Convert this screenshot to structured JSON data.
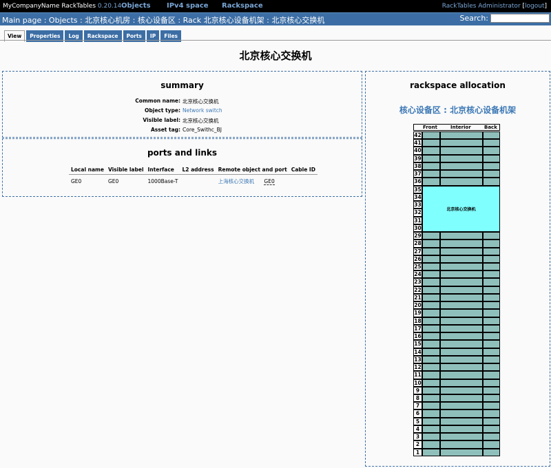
{
  "topbar": {
    "company": "MyCompanyName RackTables",
    "version": "0.20.14",
    "menu": [
      "Objects",
      "IPv4 space",
      "Rackspace"
    ],
    "user": "RackTables Administrator",
    "logout": "logout"
  },
  "breadcrumb": {
    "text": "Main page : Objects : 北京核心机房 : 核心设备区 : Rack 北京核心设备机架 : 北京核心交换机"
  },
  "search": {
    "label": "Search:",
    "value": ""
  },
  "tabs": [
    "View",
    "Properties",
    "Log",
    "Rackspace",
    "Ports",
    "IP",
    "Files"
  ],
  "page_title": "北京核心交换机",
  "summary": {
    "title": "summary",
    "rows": [
      {
        "key": "Common name:",
        "value": "北京核心交换机"
      },
      {
        "key": "Object type:",
        "value": "Network switch"
      },
      {
        "key": "Visible label:",
        "value": "北京核心交换机"
      },
      {
        "key": "Asset tag:",
        "value": "Core_Swithc_BJ"
      }
    ]
  },
  "ports": {
    "title": "ports and links",
    "headers": [
      "Local name",
      "Visible label",
      "Interface",
      "L2 address",
      "Remote object and port",
      "Cable ID"
    ],
    "rows": [
      {
        "local": "GE0",
        "visible": "GE0",
        "iface": "1000Base-T",
        "l2": "",
        "remote_obj": "上海核心交换机",
        "remote_port": "GE0",
        "cable": ""
      }
    ]
  },
  "rackspace": {
    "title": "rackspace allocation",
    "rack_title": "核心设备区 : 北京核心设备机架",
    "headers": [
      "Front",
      "Interior",
      "Back"
    ],
    "units": [
      42,
      41,
      40,
      39,
      38,
      37,
      36,
      35,
      34,
      33,
      32,
      31,
      30,
      29,
      28,
      27,
      26,
      25,
      24,
      23,
      22,
      21,
      20,
      19,
      18,
      17,
      16,
      15,
      14,
      13,
      12,
      11,
      10,
      9,
      8,
      7,
      6,
      5,
      4,
      3,
      2,
      1
    ],
    "occupied_label": "北京核心交换机",
    "occupied_from": 35,
    "occupied_to": 30
  }
}
